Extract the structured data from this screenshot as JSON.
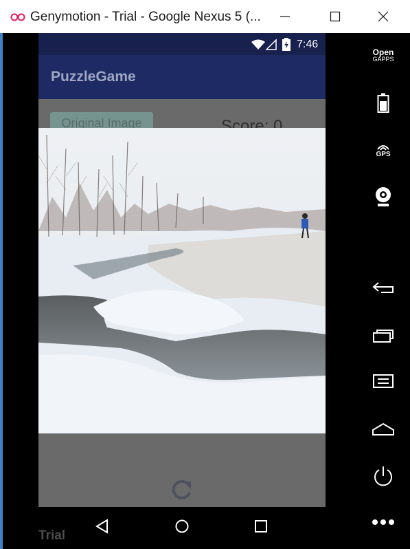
{
  "window": {
    "title": "Genymotion - Trial - Google Nexus 5 (...",
    "trial_label": "Trial"
  },
  "status_bar": {
    "time": "7:46"
  },
  "app": {
    "title": "PuzzleGame",
    "original_image_button": "Original Image",
    "score_text": "Score: 0"
  },
  "toolbar": {
    "open_gapps_line1": "Open",
    "open_gapps_line2": "GAPPS",
    "gps_label": "GPS",
    "icons": [
      "open-gapps-icon",
      "battery-icon",
      "gps-icon",
      "webcam-icon",
      "back-icon",
      "recent-apps-icon",
      "menu-icon",
      "home-icon",
      "power-icon",
      "more-icon"
    ]
  },
  "colors": {
    "status_bar": "#18204e",
    "app_bar": "#1d2a63",
    "overlay": "#6a6a6a",
    "logo": "#e4185d"
  }
}
